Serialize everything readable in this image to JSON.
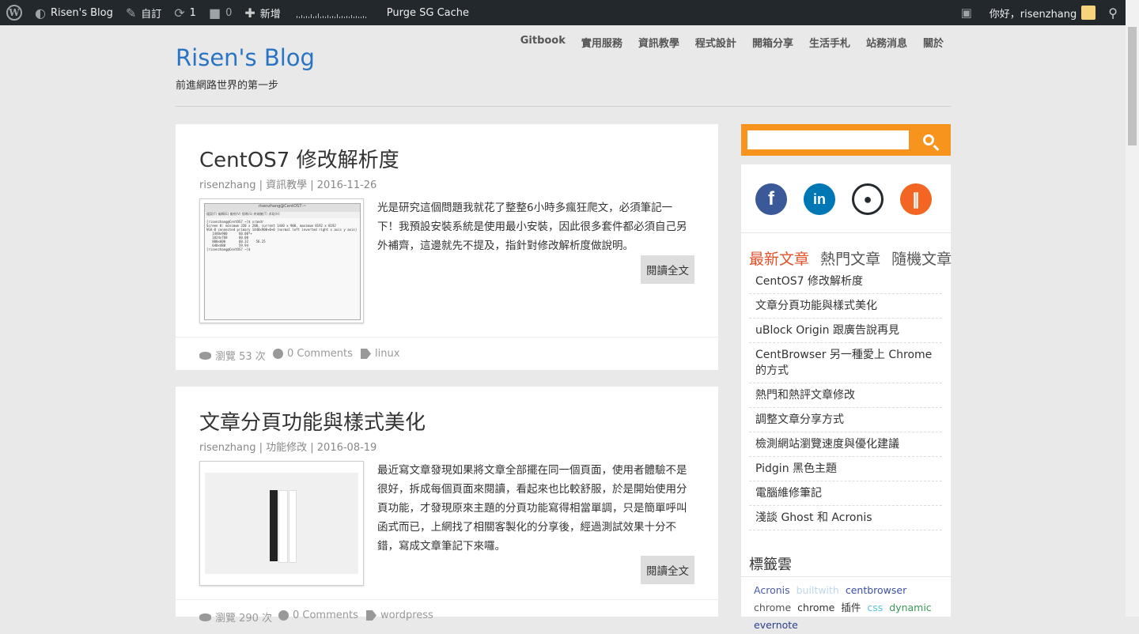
{
  "adminbar": {
    "site_name": "Risen's Blog",
    "customize": "自訂",
    "updates_count": "1",
    "comments_count": "0",
    "new_label": "新增",
    "purge": "Purge SG Cache",
    "greeting": "你好，risenzhang"
  },
  "site": {
    "title": "Risen's Blog",
    "tagline": "前進網路世界的第一步"
  },
  "nav": [
    "Gitbook",
    "實用服務",
    "資訊教學",
    "程式設計",
    "開箱分享",
    "生活手札",
    "站務消息",
    "關於"
  ],
  "posts": [
    {
      "title": "CentOS7 修改解析度",
      "meta": "risenzhang | 資訊教學 | 2016-11-26",
      "excerpt": "光是研究這個問題我就花了整整6小時多瘋狂爬文，必須筆記一下！我預設安裝系統是使用最小安裝，因此很多套件都必須自己另外補齊，這邊就先不提及，指針對修改解析度做說明。",
      "readmore": "閱讀全文",
      "views": "瀏覽 53 次",
      "comments": "0 Comments",
      "tag": "linux"
    },
    {
      "title": "文章分頁功能與樣式美化",
      "meta": "risenzhang | 功能修改 | 2016-08-19",
      "excerpt": "最近寫文章發現如果將文章全部擺在同一個頁面，使用者體驗不是很好，拆成每個頁面來閱讀，看起來也比較舒服，於是開始使用分頁功能，才發現原來主題的分頁功能寫得相當單調，只是簡單呼叫函式而已，上網找了相關客製化的分享後，經過測試效果十分不錯，寫成文章筆記下來囉。",
      "readmore": "閱讀全文",
      "views": "瀏覽 290 次",
      "comments": "0 Comments",
      "tag": "wordpress"
    }
  ],
  "terminal": {
    "title": "risenzhang@CentOS7:~",
    "menu": "檔案(F)  編輯(E)  檢視(V)  搜尋(S)  終端機(T)  求助(H)",
    "lines": "[risenzhang@CentOS7 ~]$ xrandr\nScreen 0: minimum 320 x 200, current 1440 x 900, maximum 8192 x 8192\nVGA-0 connected primary 1440x900+0+0 (normal left inverted right x axis y axis)\n   1440x900      60.00*+\n   1024x768      60.00\n   800x600       60.32    56.25\n   640x480       59.94\n[risenzhang@CentOS7 ~]$ "
  },
  "sidebar": {
    "tabs": [
      "最新文章",
      "熱門文章",
      "隨機文章"
    ],
    "recent": [
      "CentOS7 修改解析度",
      "文章分頁功能與樣式美化",
      "uBlock Origin 跟廣告說再見",
      "CentBrowser 另一種愛上 Chrome的方式",
      "熱門和熱評文章修改",
      "調整文章分享方式",
      "檢測網站瀏覽速度與優化建議",
      "Pidgin 黑色主題",
      "電腦維修筆記",
      "淺談 Ghost 和 Acronis"
    ],
    "tagcloud_title": "標籤雲",
    "tags": [
      {
        "text": "Acronis",
        "color": "#4a5aa8"
      },
      {
        "text": "builtwith",
        "color": "#bcd8f0"
      },
      {
        "text": "centbrowser",
        "color": "#3a4fa0"
      },
      {
        "text": "chrome",
        "color": "#555555"
      },
      {
        "text": "chrome",
        "color": "#333333"
      },
      {
        "text": "插件",
        "color": "#333333"
      },
      {
        "text": "css",
        "color": "#5bc0de"
      },
      {
        "text": "dynamic",
        "color": "#3a9a5a"
      },
      {
        "text": "evernote",
        "color": "#2a3f8f"
      }
    ]
  },
  "colors": {
    "accent": "#f7941d",
    "link_blue": "#2a74c4",
    "active_tab": "#e0522a",
    "facebook": "#3b5998",
    "linkedin": "#0077b5",
    "github": "#24292e",
    "rss": "#f26522"
  },
  "icons": [
    "wordpress-icon",
    "dashboard-icon",
    "brush-icon",
    "refresh-icon",
    "comment-icon",
    "plus-icon",
    "search-icon",
    "facebook-icon",
    "linkedin-icon",
    "github-icon",
    "rss-icon",
    "eye-icon",
    "tag-icon"
  ]
}
